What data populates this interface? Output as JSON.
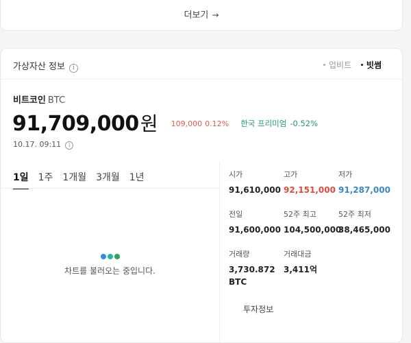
{
  "more": {
    "label": "더보기",
    "arrow": "→"
  },
  "info": {
    "title": "가상자산 정보",
    "exchanges": [
      {
        "label": "업비트",
        "active": false
      },
      {
        "label": "빗썸",
        "active": true
      }
    ]
  },
  "coin": {
    "name": "비트코인",
    "symbol": "BTC",
    "price": "91,709,000",
    "unit": "원",
    "change_amount": "109,000",
    "change_pct": "0.12%",
    "premium_label": "한국 프리미엄",
    "premium_value": "-0.52%",
    "timestamp": "10.17. 09:11"
  },
  "tabs": [
    "1일",
    "1주",
    "1개월",
    "3개월",
    "1년"
  ],
  "chart": {
    "loading_text": "차트를 불러오는 중입니다.",
    "dot_colors": [
      "#2e8ee0",
      "#27b7a0",
      "#2aa55a"
    ]
  },
  "stats": {
    "open": {
      "label": "시가",
      "value": "91,610,000"
    },
    "high": {
      "label": "고가",
      "value": "92,151,000"
    },
    "low": {
      "label": "저가",
      "value": "91,287,000"
    },
    "prev_close": {
      "label": "전일",
      "value": "91,600,000"
    },
    "high_52w": {
      "label": "52주 최고",
      "value": "104,500,000"
    },
    "low_52w": {
      "label": "52주 최저",
      "value": "38,465,000"
    },
    "volume": {
      "label": "거래량",
      "value": "3,730.872",
      "unit": "BTC"
    },
    "trade_value": {
      "label": "거래대금",
      "value": "3,411억"
    }
  },
  "invest_link": "투자정보",
  "colors": {
    "up": "#e0493c",
    "down": "#3a86c8",
    "premium": "#1f9e6a"
  }
}
